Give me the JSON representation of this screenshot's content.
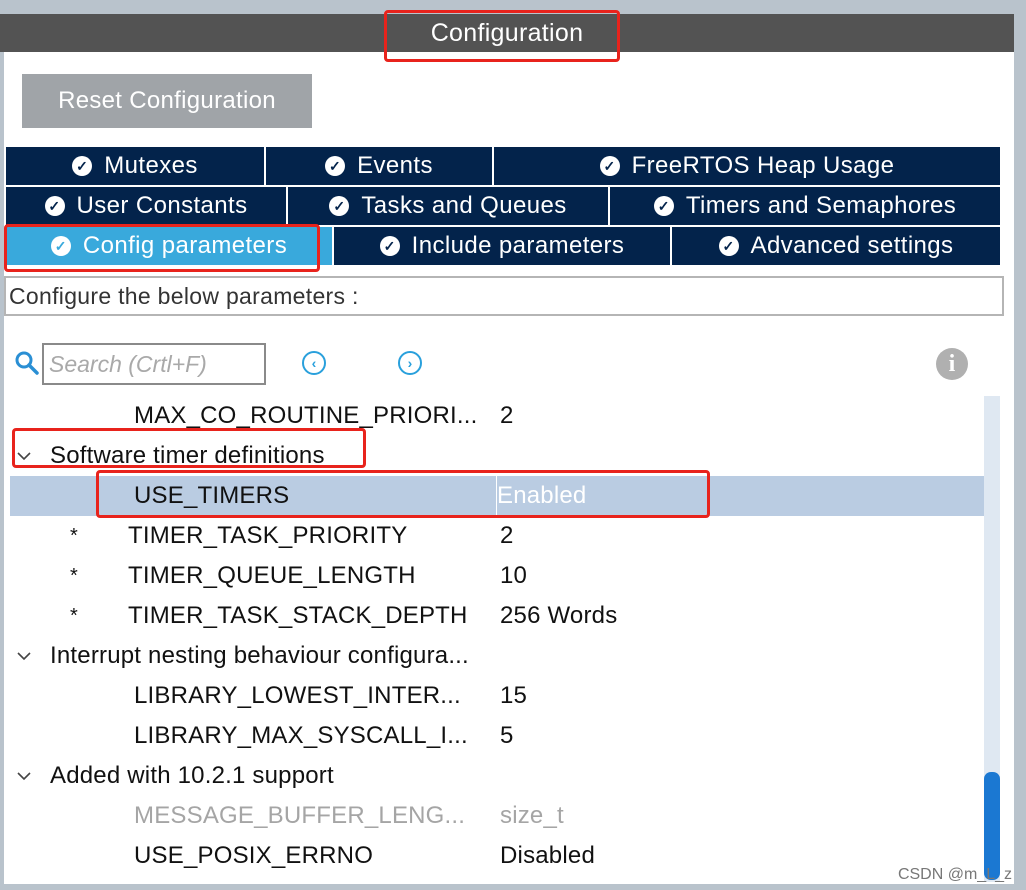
{
  "window": {
    "title": "Configuration"
  },
  "toolbar": {
    "reset_label": "Reset Configuration"
  },
  "tabs": {
    "row1": [
      {
        "label": "Mutexes"
      },
      {
        "label": "Events"
      },
      {
        "label": "FreeRTOS Heap Usage"
      }
    ],
    "row2": [
      {
        "label": "User Constants"
      },
      {
        "label": "Tasks and Queues"
      },
      {
        "label": "Timers and Semaphores"
      }
    ],
    "row3": [
      {
        "label": "Config parameters",
        "active": true
      },
      {
        "label": "Include parameters"
      },
      {
        "label": "Advanced settings"
      }
    ]
  },
  "description": "Configure the below parameters :",
  "search": {
    "placeholder": "Search (Crtl+F)"
  },
  "tree": [
    {
      "name": "MAX_CO_ROUTINE_PRIORI...",
      "value": "2"
    },
    {
      "group": "Software timer definitions"
    },
    {
      "name": "USE_TIMERS",
      "value": "Enabled",
      "selected": true
    },
    {
      "name": "TIMER_TASK_PRIORITY",
      "value": "2",
      "star": "*"
    },
    {
      "name": "TIMER_QUEUE_LENGTH",
      "value": "10",
      "star": "*"
    },
    {
      "name": "TIMER_TASK_STACK_DEPTH",
      "value": "256 Words",
      "star": "*"
    },
    {
      "group": "Interrupt nesting behaviour configura..."
    },
    {
      "name": "LIBRARY_LOWEST_INTER...",
      "value": "15"
    },
    {
      "name": "LIBRARY_MAX_SYSCALL_I...",
      "value": "5"
    },
    {
      "group": "Added with 10.2.1 support"
    },
    {
      "name": "MESSAGE_BUFFER_LENG...",
      "value": "size_t",
      "dim": true
    },
    {
      "name": "USE_POSIX_ERRNO",
      "value": "Disabled"
    }
  ],
  "watermark": "CSDN @m_L_z",
  "colors": {
    "tab_bg": "#03234b",
    "tab_active_bg": "#39a9dc",
    "title_bg": "#535353",
    "highlight_red": "#e8231c",
    "selected_row": "#bacce2"
  }
}
